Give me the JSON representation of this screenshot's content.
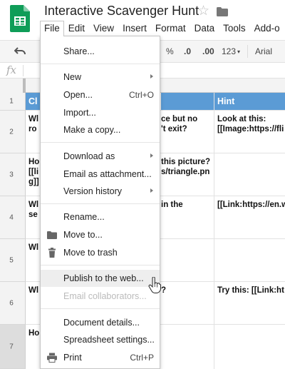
{
  "app": {
    "title": "Interactive Scavenger Hunt",
    "brand_color": "#0f9d58"
  },
  "menubar": {
    "items": [
      "File",
      "Edit",
      "View",
      "Insert",
      "Format",
      "Data",
      "Tools",
      "Add-o"
    ],
    "active": "File"
  },
  "toolbar": {
    "percent": "%",
    "dec_decrease": ".0",
    "dec_increase": ".00",
    "number_format": "123",
    "font": "Arial"
  },
  "formula_bar": {
    "fx": "fx",
    "value": ""
  },
  "grid": {
    "header_color": "#5b9bd5",
    "headers": {
      "a_partial": "Cl",
      "c_hint": "Hint"
    },
    "row_numbers": [
      "1",
      "2",
      "3",
      "4",
      "5",
      "6",
      "7"
    ],
    "selected_row": "7",
    "cells": {
      "r2_a": "Wl\nro",
      "r2_b": "ce but no\n't exit?",
      "r2_c": "Look at this:\n[[Image:https://fli",
      "r3_a": "Ho\n[[li\ng]]",
      "r3_b": "this picture?\ns/triangle.pn",
      "r4_a": "Wl\nse",
      "r4_b": "in the",
      "r4_c": "[[Link:https://en.w",
      "r5_a": "Wl",
      "r6_a": "Wl",
      "r6_b": "?",
      "r6_c": "Try this: [[Link:ht",
      "r7_a": "Ho"
    }
  },
  "file_menu": {
    "share": "Share...",
    "new": "New",
    "open": "Open...",
    "open_shortcut": "Ctrl+O",
    "import": "Import...",
    "make_copy": "Make a copy...",
    "download_as": "Download as",
    "email_attachment": "Email as attachment...",
    "version_history": "Version history",
    "rename": "Rename...",
    "move_to": "Move to...",
    "move_to_trash": "Move to trash",
    "publish": "Publish to the web...",
    "email_collaborators": "Email collaborators...",
    "document_details": "Document details...",
    "spreadsheet_settings": "Spreadsheet settings...",
    "print": "Print",
    "print_shortcut": "Ctrl+P"
  }
}
